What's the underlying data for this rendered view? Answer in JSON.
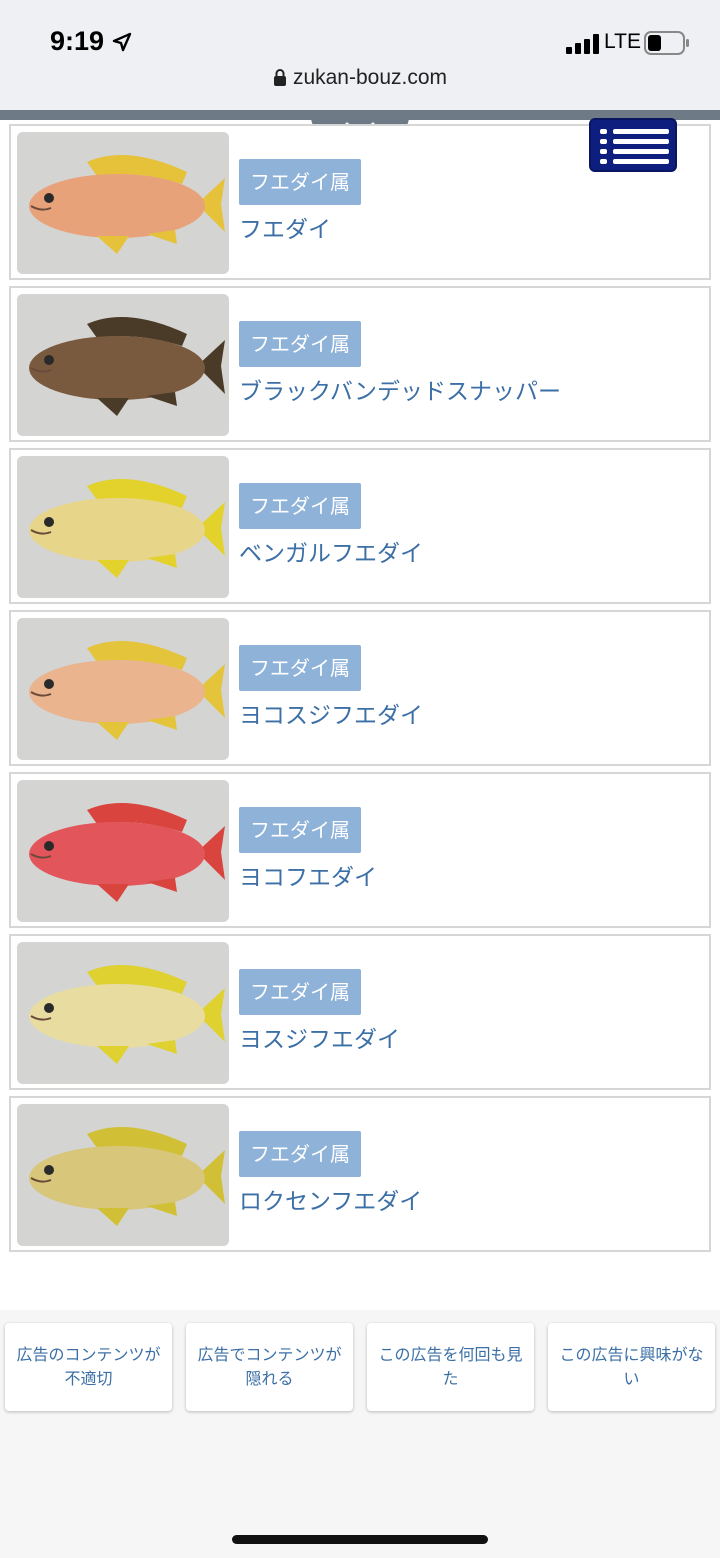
{
  "status_bar": {
    "time": "9:19",
    "network": "LTE"
  },
  "browser": {
    "url": "zukan-bouz.com"
  },
  "fish_list": [
    {
      "genus": "フエダイ属",
      "name": "フエダイ",
      "body_color": "#e8a27a",
      "fin_color": "#e6c13a"
    },
    {
      "genus": "フエダイ属",
      "name": "ブラックバンデッドスナッパー",
      "body_color": "#7a5a3e",
      "fin_color": "#4a3a28"
    },
    {
      "genus": "フエダイ属",
      "name": "ベンガルフエダイ",
      "body_color": "#e7d58a",
      "fin_color": "#e3d12c"
    },
    {
      "genus": "フエダイ属",
      "name": "ヨコスジフエダイ",
      "body_color": "#eab48f",
      "fin_color": "#e3c43a"
    },
    {
      "genus": "フエダイ属",
      "name": "ヨコフエダイ",
      "body_color": "#e2555a",
      "fin_color": "#d9443f"
    },
    {
      "genus": "フエダイ属",
      "name": "ヨスジフエダイ",
      "body_color": "#e8dca0",
      "fin_color": "#dfd130"
    },
    {
      "genus": "フエダイ属",
      "name": "ロクセンフエダイ",
      "body_color": "#d8c67a",
      "fin_color": "#d1c035"
    }
  ],
  "ad_feedback": [
    {
      "label": "広告のコンテンツが不適切"
    },
    {
      "label": "広告でコンテンツが隠れる"
    },
    {
      "label": "この広告を何回も見た"
    },
    {
      "label": "この広告に興味がない"
    }
  ],
  "colors": {
    "badge": "#8eb2d8",
    "link": "#3b6fa5",
    "menu": "#0d1e7f"
  }
}
